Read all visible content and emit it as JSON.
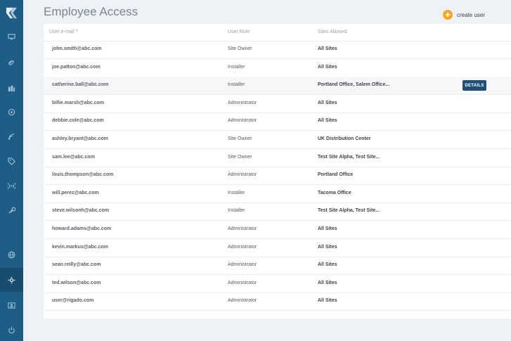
{
  "page": {
    "title": "Employee Access"
  },
  "header": {
    "create_user_label": "create user"
  },
  "colors": {
    "sidebar": "#1e5d86",
    "accent": "#f5a623",
    "details_button": "#1f4f79"
  },
  "sidebar": {
    "items": [
      {
        "icon": "monitor-icon"
      },
      {
        "icon": "paperclip-icon"
      },
      {
        "icon": "building-icon"
      },
      {
        "icon": "location-pin-icon"
      },
      {
        "icon": "signal-icon"
      },
      {
        "icon": "tag-icon"
      },
      {
        "icon": "broadcast-icon"
      },
      {
        "icon": "wrench-icon"
      },
      {
        "icon": "globe-icon"
      },
      {
        "icon": "gear-icon",
        "active": true
      },
      {
        "icon": "user-card-icon"
      },
      {
        "icon": "power-icon"
      }
    ]
  },
  "table": {
    "columns": {
      "email": "User e-mail",
      "email_sort": "^",
      "role": "User Role",
      "sites": "Sites Allowed"
    },
    "details_label": "DETAILS",
    "rows": [
      {
        "email": "john.smith@abc.com",
        "role": "Site Owner",
        "sites": "All Sites"
      },
      {
        "email": "joe.patton@abc.com",
        "role": "Installer",
        "sites": "All Sites"
      },
      {
        "email": "catherine.ball@abc.com",
        "role": "Installer",
        "sites": "Portland Office, Salem Office...",
        "highlighted": true
      },
      {
        "email": "billie.marsh@abc.com",
        "role": "Administrator",
        "sites": "All Sites"
      },
      {
        "email": "debbie.cole@abc.com",
        "role": "Administrator",
        "sites": "All Sites"
      },
      {
        "email": "ashley.bryant@abc.com",
        "role": "Site Owner",
        "sites": "UK Distribution Center"
      },
      {
        "email": "sam.lee@abc.com",
        "role": "Site Owner",
        "sites": "Test Site Alpha, Test Site..."
      },
      {
        "email": "louis.thompson@abc.com",
        "role": "Administrator",
        "sites": "Portland Office"
      },
      {
        "email": "will.perez@abc.com",
        "role": "Installer",
        "sites": "Tacoma Office"
      },
      {
        "email": "steve.wilsonh@abc.com",
        "role": "Installer",
        "sites": "Test Site Alpha, Test Site..."
      },
      {
        "email": "howard.adams@abc.com",
        "role": "Administrator",
        "sites": "All Sites"
      },
      {
        "email": "kevin.markus@abc.com",
        "role": "Administrator",
        "sites": "All Sites"
      },
      {
        "email": "sean.reilly@abc.com",
        "role": "Administrator",
        "sites": "All Sites"
      },
      {
        "email": "ted.wilson@abc.com",
        "role": "Administrator",
        "sites": "All Sites"
      },
      {
        "email": "user@rigado.com",
        "role": "Administrator",
        "sites": "All Sites"
      }
    ]
  }
}
